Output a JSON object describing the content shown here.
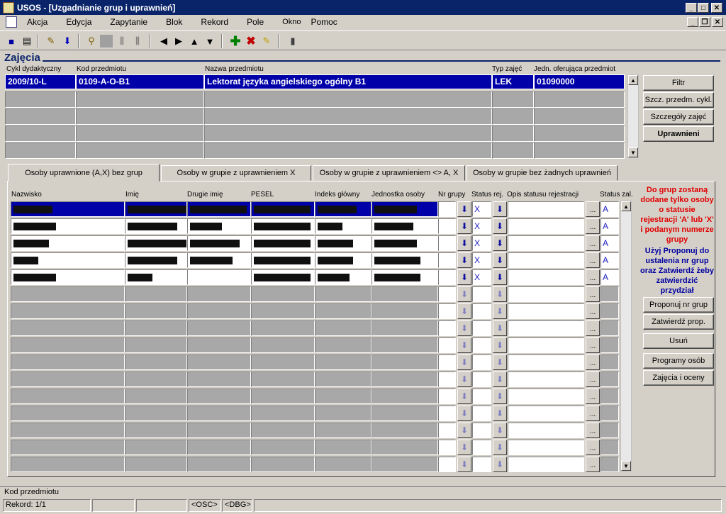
{
  "window": {
    "title": "USOS - [Uzgadnianie grup i uprawnień]"
  },
  "menu": [
    {
      "label": "Akcja"
    },
    {
      "label": "Edycja"
    },
    {
      "label": "Zapytanie"
    },
    {
      "label": "Blok"
    },
    {
      "label": "Rekord"
    },
    {
      "label": "Pole"
    },
    {
      "label": "Okno"
    },
    {
      "label": "Pomoc"
    }
  ],
  "section": {
    "title": "Zajęcia"
  },
  "zajecia": {
    "headers": {
      "cykl": "Cykl dydaktyczny",
      "kod": "Kod przedmiotu",
      "nazwa": "Nazwa przedmiotu",
      "typ": "Typ zajęć",
      "jedn": "Jedn. oferująca przedmiot"
    },
    "row": {
      "cykl": "2009/10-L",
      "kod": "0109-A-O-B1",
      "nazwa": "Lektorat języka angielskiego ogólny B1",
      "typ": "LEK",
      "jedn": "01090000"
    }
  },
  "right_buttons": {
    "filtr": "Filtr",
    "szcz_przedm": "Szcz. przedm. cykl.",
    "szczegoly": "Szczegóły zajęć",
    "uprawnienia": "Uprawnieni"
  },
  "tabs": [
    {
      "label": "Osoby uprawnione (A,X) bez grup"
    },
    {
      "label": "Osoby w grupie z uprawnieniem X"
    },
    {
      "label": "Osoby w grupie z uprawnieniem <> A, X"
    },
    {
      "label": "Osoby w grupie bez żadnych uprawnień"
    }
  ],
  "grid": {
    "headers": {
      "nazwisko": "Nazwisko",
      "imie": "Imię",
      "drugie": "Drugie imię",
      "pesel": "PESEL",
      "indeks": "Indeks główny",
      "jednostka": "Jednostka osoby",
      "nr_grupy": "Nr grupy",
      "status_rej": "Status rej.",
      "opis": "Opis statusu rejestracji",
      "status_zal": "Status zal."
    },
    "rows": [
      {
        "status": "X",
        "zal": "A"
      },
      {
        "status": "X",
        "zal": "A"
      },
      {
        "status": "X",
        "zal": "A"
      },
      {
        "status": "X",
        "zal": "A"
      },
      {
        "status": "X",
        "zal": "A"
      }
    ],
    "dot_label": "..."
  },
  "info": {
    "red": "Do grup zostaną dodane tylko osoby o statusie rejestracji 'A' lub 'X' i podanym numerze grupy",
    "blue": "Użyj Proponuj do ustalenia nr grup oraz Zatwierdź żeby zatwierdzić przydział"
  },
  "action_buttons": {
    "proponuj": "Proponuj nr grup",
    "zatwierdz": "Zatwierdź prop.",
    "usun": "Usuń",
    "programy": "Programy osób",
    "zajecia_oceny": "Zajęcia i oceny"
  },
  "status": {
    "field": "Kod przedmiotu",
    "record": "Rekord: 1/1",
    "osc": "<OSC>",
    "dbg": "<DBG>"
  }
}
